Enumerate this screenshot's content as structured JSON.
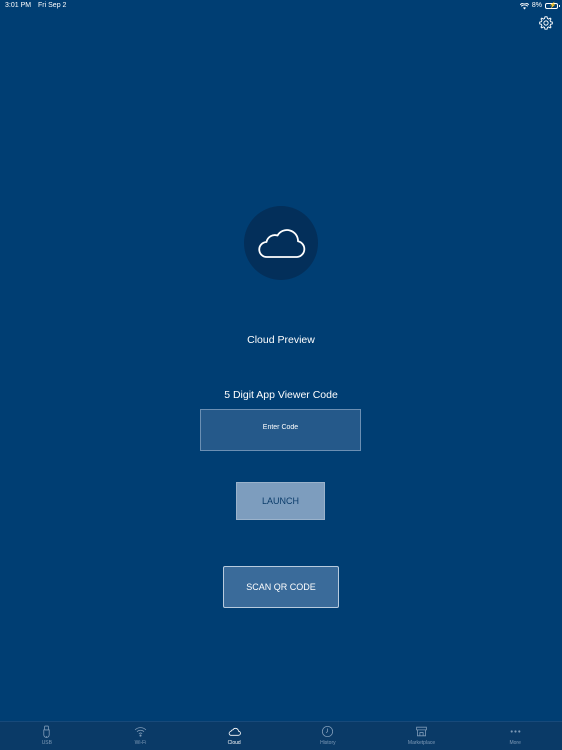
{
  "status_bar": {
    "time": "3:01 PM",
    "date": "Fri Sep 2",
    "battery": "8%"
  },
  "icons": {
    "settings": "gear-icon",
    "main": "cloud-icon",
    "wifi": "wifi-icon",
    "battery": "battery-icon"
  },
  "main": {
    "title": "Cloud Preview",
    "code_label": "5 Digit App Viewer Code",
    "code_placeholder": "Enter Code",
    "code_value": "",
    "launch_label": "LAUNCH",
    "scan_label": "SCAN QR CODE"
  },
  "tabs": [
    {
      "label": "USB",
      "icon": "usb-icon",
      "active": false
    },
    {
      "label": "Wi-Fi",
      "icon": "wifi-icon",
      "active": false
    },
    {
      "label": "Cloud",
      "icon": "cloud-icon",
      "active": true
    },
    {
      "label": "History",
      "icon": "clock-icon",
      "active": false
    },
    {
      "label": "Marketplace",
      "icon": "store-icon",
      "active": false
    },
    {
      "label": "More",
      "icon": "more-icon",
      "active": false
    }
  ],
  "colors": {
    "background": "#003e73",
    "tab_bar": "#0a3a67",
    "active_tab": "#ffffff",
    "inactive_tab": "#7f9bb8",
    "launch_button": "#7d9dbe"
  }
}
